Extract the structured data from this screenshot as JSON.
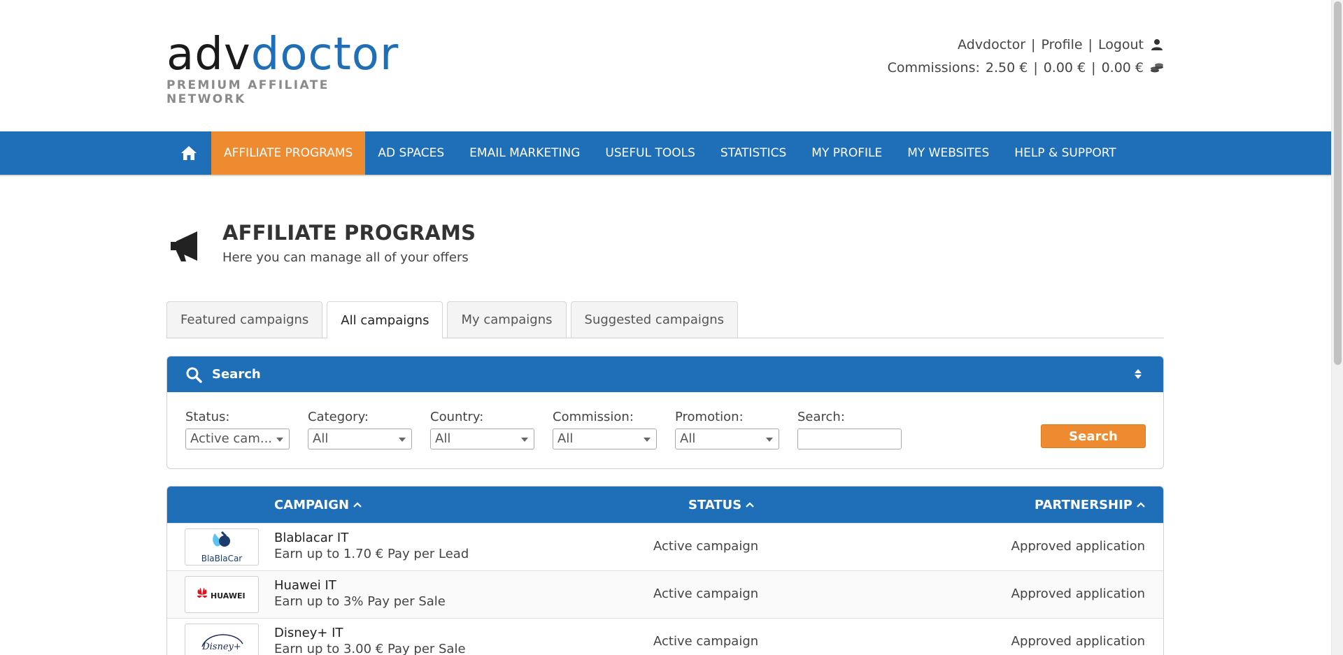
{
  "header": {
    "logo": {
      "part1": "adv",
      "part2": "doctor",
      "tagline": "PREMIUM AFFILIATE NETWORK"
    },
    "user_links": [
      "Advdoctor",
      "Profile",
      "Logout"
    ],
    "commissions": {
      "label": "Commissions:",
      "values": [
        "2.50 €",
        "0.00 €",
        "0.00 €"
      ]
    },
    "icons": {
      "user": "user-icon",
      "coins": "coins-icon"
    }
  },
  "nav": {
    "home_icon": "home-icon",
    "items": [
      "AFFILIATE PROGRAMS",
      "AD SPACES",
      "EMAIL MARKETING",
      "USEFUL TOOLS",
      "STATISTICS",
      "MY PROFILE",
      "MY WEBSITES",
      "HELP & SUPPORT"
    ],
    "active": "AFFILIATE PROGRAMS"
  },
  "page": {
    "title": "AFFILIATE PROGRAMS",
    "subtitle": "Here you can manage all of your offers",
    "icon": "megaphone-icon"
  },
  "tabs": [
    "Featured campaigns",
    "All campaigns",
    "My campaigns",
    "Suggested campaigns"
  ],
  "active_tab": "All campaigns",
  "search": {
    "title": "Search",
    "filters": [
      {
        "label": "Status:",
        "value": "Active cam..."
      },
      {
        "label": "Category:",
        "value": "All"
      },
      {
        "label": "Country:",
        "value": "All"
      },
      {
        "label": "Commission:",
        "value": "All"
      },
      {
        "label": "Promotion:",
        "value": "All"
      }
    ],
    "text_label": "Search:",
    "text_value": "",
    "button": "Search"
  },
  "table": {
    "headers": {
      "campaign": "CAMPAIGN",
      "status": "STATUS",
      "partnership": "PARTNERSHIP"
    },
    "rows": [
      {
        "logo_text": "BlaBlaCar",
        "name": "Blablacar IT",
        "desc": "Earn up to 1.70 € Pay per Lead",
        "status": "Active campaign",
        "partnership": "Approved application"
      },
      {
        "logo_text": "HUAWEI",
        "name": "Huawei IT",
        "desc": "Earn up to 3% Pay per Sale",
        "status": "Active campaign",
        "partnership": "Approved application"
      },
      {
        "logo_text": "Disney+",
        "name": "Disney+ IT",
        "desc": "Earn up to 3.00 € Pay per Sale",
        "status": "Active campaign",
        "partnership": "Approved application"
      }
    ]
  },
  "colors": {
    "primary": "#1f6fb8",
    "accent": "#ee8a2f"
  }
}
